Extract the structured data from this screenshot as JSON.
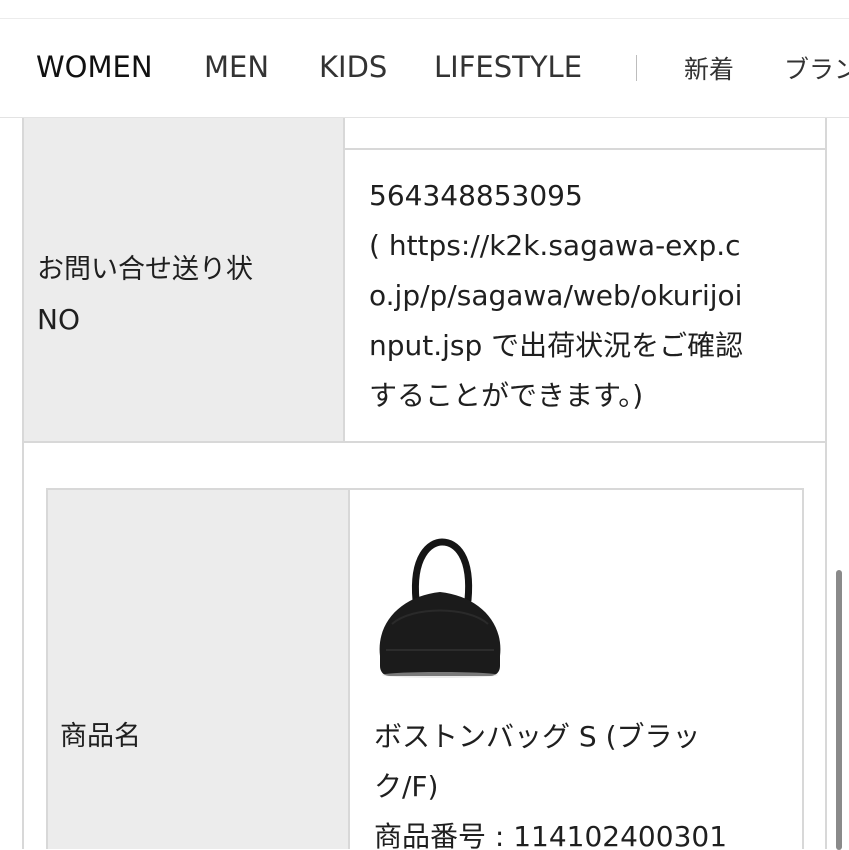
{
  "nav": {
    "items": [
      {
        "label": "WOMEN"
      },
      {
        "label": "MEN"
      },
      {
        "label": "KIDS"
      },
      {
        "label": "LIFESTYLE"
      }
    ],
    "separator": "|",
    "jp_items": [
      {
        "label": "新着"
      },
      {
        "label": "ブラン"
      }
    ]
  },
  "tracking": {
    "label_line1": "お問い合せ送り状",
    "label_line2": "NO",
    "value_lines": [
      "564348853095",
      "( https://k2k.sagawa-exp.c",
      "o.jp/p/sagawa/web/okurijoi",
      "nput.jsp で出荷状況をご確認",
      "することができます。)"
    ]
  },
  "product": {
    "label": "商品名",
    "name_line1": "ボストンバッグ S (ブラッ",
    "name_line2": "ク/F)",
    "number_line": "商品番号 : 114102400301",
    "image_icon": "boston-bag-image"
  },
  "colors": {
    "label_bg": "#ececec",
    "border": "#d8d8d8",
    "text": "#1f1f1f"
  }
}
